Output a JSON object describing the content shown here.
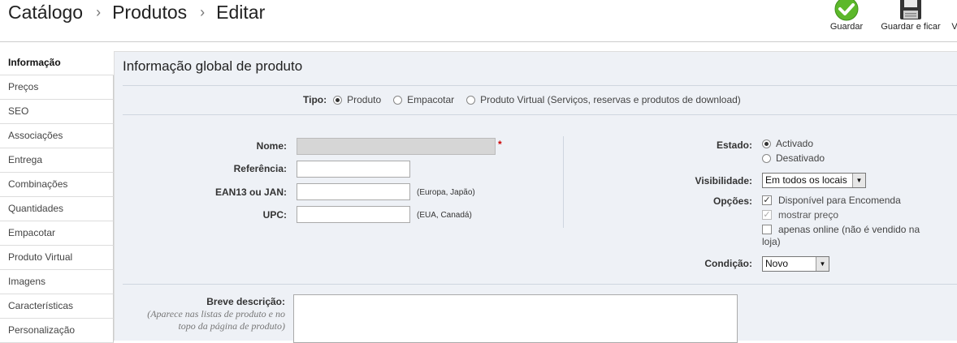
{
  "breadcrumb": [
    "Catálogo",
    "Produtos",
    "Editar"
  ],
  "toolbar": {
    "save_label": "Guardar",
    "save_stay_label": "Guardar e ficar",
    "more_label": "V"
  },
  "sidebar": {
    "items": [
      {
        "label": "Informação",
        "active": true
      },
      {
        "label": "Preços"
      },
      {
        "label": "SEO"
      },
      {
        "label": "Associações"
      },
      {
        "label": "Entrega"
      },
      {
        "label": "Combinações"
      },
      {
        "label": "Quantidades"
      },
      {
        "label": "Empacotar"
      },
      {
        "label": "Produto Virtual"
      },
      {
        "label": "Imagens"
      },
      {
        "label": "Características"
      },
      {
        "label": "Personalização"
      }
    ]
  },
  "panel": {
    "title": "Informação global de produto"
  },
  "tipo": {
    "label": "Tipo:",
    "options": [
      "Produto",
      "Empacotar",
      "Produto Virtual (Serviços, reservas e produtos de download)"
    ],
    "selected": "Produto"
  },
  "fields": {
    "nome_label": "Nome:",
    "nome_value": "",
    "referencia_label": "Referência:",
    "referencia_value": "",
    "ean_label": "EAN13 ou JAN:",
    "ean_value": "",
    "ean_hint": "(Europa, Japão)",
    "upc_label": "UPC:",
    "upc_value": "",
    "upc_hint": "(EUA, Canadá)",
    "required_mark": "*"
  },
  "estado": {
    "label": "Estado:",
    "options": [
      "Activado",
      "Desativado"
    ],
    "selected": "Activado"
  },
  "visibilidade": {
    "label": "Visibilidade:",
    "value": "Em todos os locais"
  },
  "opcoes": {
    "label": "Opções:",
    "items": [
      {
        "label": "Disponível para Encomenda",
        "checked": true
      },
      {
        "label": "mostrar preço",
        "checked": true,
        "disabled": true
      },
      {
        "label": "apenas online (não é vendido na",
        "label_cont": "loja)",
        "checked": false
      }
    ]
  },
  "condicao": {
    "label": "Condição:",
    "value": "Novo"
  },
  "descricao": {
    "label": "Breve descrição:",
    "hint_line1": "(Aparece nas listas de produto e no",
    "hint_line2": "topo da página de produto)"
  },
  "colors": {
    "panel_bg": "#eef1f6",
    "save_green": "#5cb82a"
  },
  "icons": {
    "save": "green-check-icon",
    "save_stay": "floppy-disk-icon"
  }
}
